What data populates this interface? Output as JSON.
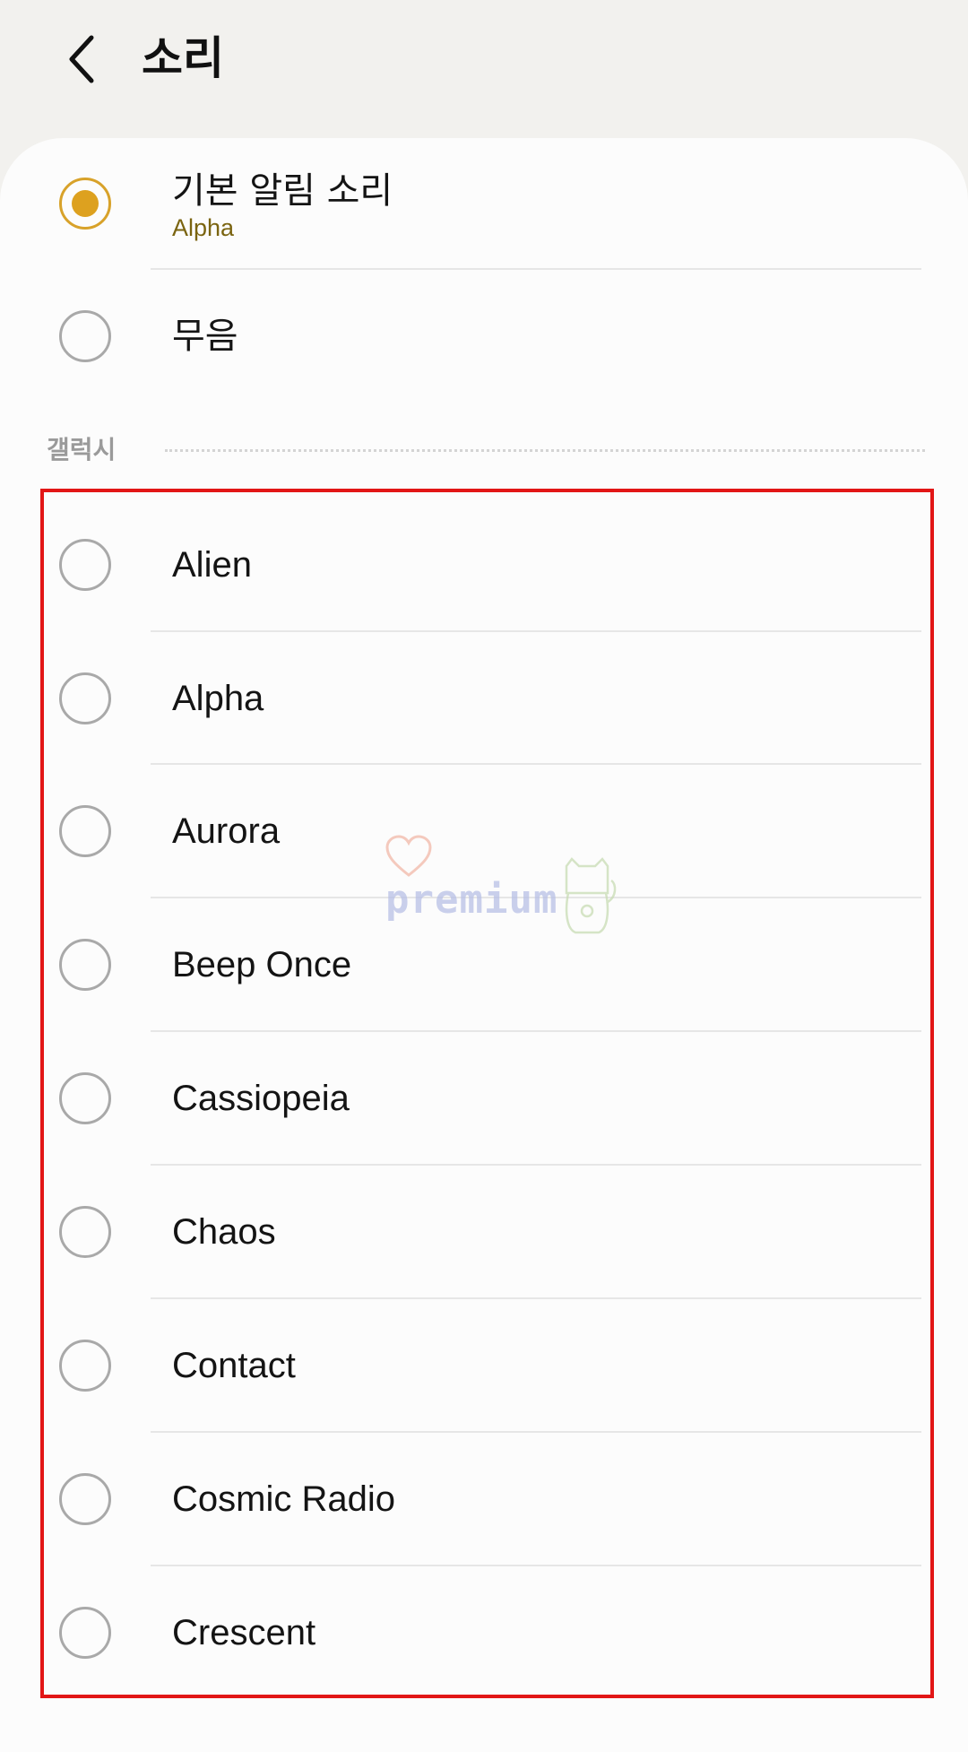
{
  "header": {
    "title": "소리",
    "back_icon": "chevron-left-icon"
  },
  "default_options": [
    {
      "label": "기본 알림 소리",
      "sublabel": "Alpha",
      "selected": true
    },
    {
      "label": "무음",
      "selected": false
    }
  ],
  "section": {
    "title": "갤럭시"
  },
  "sounds": [
    {
      "label": "Alien",
      "selected": false
    },
    {
      "label": "Alpha",
      "selected": false
    },
    {
      "label": "Aurora",
      "selected": false
    },
    {
      "label": "Beep Once",
      "selected": false
    },
    {
      "label": "Cassiopeia",
      "selected": false
    },
    {
      "label": "Chaos",
      "selected": false
    },
    {
      "label": "Contact",
      "selected": false
    },
    {
      "label": "Cosmic Radio",
      "selected": false
    },
    {
      "label": "Crescent",
      "selected": false
    }
  ],
  "watermark": {
    "text": "premium"
  },
  "colors": {
    "accent": "#dda11f",
    "highlight_border": "#e21616",
    "background": "#f2f1ee",
    "card": "#fcfcfc"
  }
}
